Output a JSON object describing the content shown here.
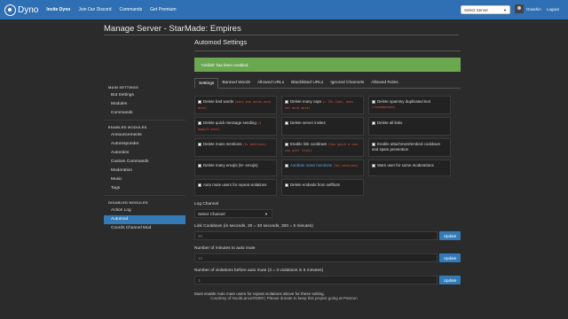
{
  "nav": {
    "brand": "Dyno",
    "links": [
      "Invite Dyno",
      "Join Our Discord",
      "Commands",
      "Get Premium"
    ],
    "server_select": "Select Server",
    "username": "Gnashin",
    "logout": "Logout"
  },
  "page_title": "Manage Server - StarMade: Empires",
  "sidebar": {
    "main_heading": "MAIN SETTINGS",
    "main_items": [
      "Bot Settings",
      "Modules",
      "Commands"
    ],
    "enabled_heading": "ENABLED MODULES",
    "enabled_items": [
      "Announcements",
      "Autoresponder",
      "Autoroles",
      "Custom Commands",
      "Moderation",
      "Music",
      "Tags"
    ],
    "disabled_heading": "DISABLED MODULES",
    "disabled_items": [
      "Action Log",
      "Automod",
      "Coords Channel Mod"
    ]
  },
  "main": {
    "section_title": "Automod Settings",
    "alert": "'Antilink' has been enabled.",
    "tabs": [
      "Settings",
      "Banned Words",
      "Allowed URLs",
      "Blacklisted URLs",
      "Ignored Channels",
      "Allowed Roles"
    ],
    "options": [
      {
        "label": "Delete bad words",
        "code": "(bans bad words auto mute)",
        "checked": false
      },
      {
        "label": "Delete many caps",
        "code": "(> 70% Caps, does not auto mute)",
        "checked": false
      },
      {
        "label": "Delete spammy duplicated text",
        "code": "(recommended)",
        "checked": false
      },
      {
        "label": "Delete quick message sending",
        "code": "(5 msgs/5 secs)",
        "checked": false
      },
      {
        "label": "Delete server invites",
        "code": "",
        "checked": false
      },
      {
        "label": "Delete all links",
        "code": "",
        "checked": false
      },
      {
        "label": "Delete mass mentions",
        "code": "(5+ mentions)",
        "checked": false
      },
      {
        "label": "Enable link cooldown",
        "code": "(how quick a user can post links)",
        "checked": false
      },
      {
        "label": "Enable attachment/embed cooldown and spam prevention",
        "code": "",
        "checked": false
      },
      {
        "label": "Delete many emojis (5+ emojis)",
        "code": "",
        "checked": false
      },
      {
        "label": "Autoban mass mentions",
        "code": "(10+ mentions)",
        "checked": false
      },
      {
        "label": "Warn user for some moderations",
        "code": "",
        "checked": false
      },
      {
        "label": "Auto mute users for repeat violations",
        "code": "",
        "checked": false
      },
      {
        "label": "Delete embeds from selfbots",
        "code": "",
        "checked": false
      }
    ],
    "log_channel_label": "Log Channel",
    "log_channel_value": "Select Channel",
    "link_cooldown_label": "Link Cooldown (in seconds, 30 = 30 seconds, 300 = 5 minutes)",
    "link_cooldown_value": "30",
    "mute_minutes_label": "Number of minutes to auto mute",
    "mute_minutes_value": "10",
    "violations_label": "Number of violations before auto mute (3 = 3 violations in 5 minutes)",
    "violations_value": "3",
    "update_label": "Update",
    "note": "Must enable Auto mute users for repeat violations above for these setting."
  },
  "footer": "Courtesy of NoobLance#3300 | Please donate to keep this project going at Patreon"
}
